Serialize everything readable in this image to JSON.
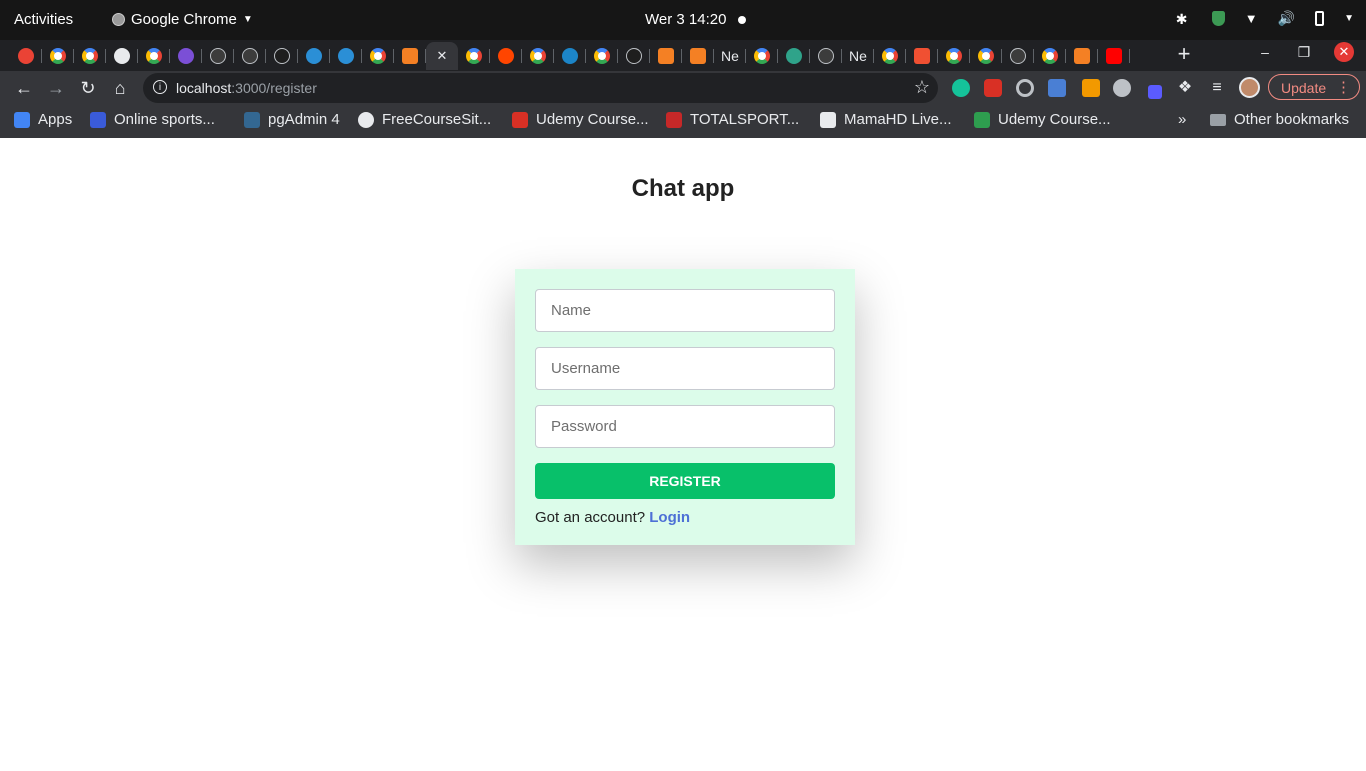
{
  "os_topbar": {
    "activities": "Activities",
    "app_name": "Google Chrome",
    "clock": "Wer 3  14:20"
  },
  "tabs": [
    {
      "icon": "gmail-icon",
      "active": false
    },
    {
      "icon": "google-icon",
      "active": false
    },
    {
      "icon": "google-icon",
      "active": false
    },
    {
      "icon": "globe-icon",
      "active": false
    },
    {
      "icon": "google-icon",
      "active": false
    },
    {
      "icon": "layers-icon",
      "active": false
    },
    {
      "icon": "github-icon",
      "active": false
    },
    {
      "icon": "github-icon",
      "active": false
    },
    {
      "icon": "compass-icon",
      "active": false
    },
    {
      "icon": "mysql-icon",
      "active": false
    },
    {
      "icon": "mysql-icon",
      "active": false
    },
    {
      "icon": "google-icon",
      "active": false
    },
    {
      "icon": "stackoverflow-icon",
      "active": false
    },
    {
      "icon": "sa-icon",
      "active": true
    },
    {
      "icon": "google-icon",
      "active": false
    },
    {
      "icon": "reddit-icon",
      "active": false
    },
    {
      "icon": "google-icon",
      "active": false
    },
    {
      "icon": "sequelize-icon",
      "active": false
    },
    {
      "icon": "google-icon",
      "active": false
    },
    {
      "icon": "compass-icon",
      "active": false
    },
    {
      "icon": "stackoverflow-icon",
      "active": false
    },
    {
      "icon": "stackoverflow-icon",
      "active": false
    },
    {
      "icon": "ne-icon",
      "active": false,
      "text": "Ne"
    },
    {
      "icon": "google-icon",
      "active": false
    },
    {
      "icon": "node-icon",
      "active": false
    },
    {
      "icon": "github-icon",
      "active": false
    },
    {
      "icon": "ne-icon",
      "active": false,
      "text": "Ne"
    },
    {
      "icon": "google-icon",
      "active": false
    },
    {
      "icon": "git-icon",
      "active": false
    },
    {
      "icon": "google-icon",
      "active": false
    },
    {
      "icon": "google-icon",
      "active": false
    },
    {
      "icon": "github-icon",
      "active": false
    },
    {
      "icon": "google-icon",
      "active": false
    },
    {
      "icon": "stackoverflow-icon",
      "active": false
    },
    {
      "icon": "youtube-icon",
      "active": false
    }
  ],
  "toolbar": {
    "url_host": "localhost",
    "url_path": ":3000/register",
    "update_label": "Update"
  },
  "bookmarks": [
    {
      "label": "Apps",
      "icon": "apps-grid-icon"
    },
    {
      "label": "Online sports...",
      "icon": "fx-icon"
    },
    {
      "label": "pgAdmin 4",
      "icon": "pg-icon"
    },
    {
      "label": "FreeCourseSit...",
      "icon": "globe-icon"
    },
    {
      "label": "Udemy Course...",
      "icon": "free-icon"
    },
    {
      "label": "TOTALSPORT...",
      "icon": "ts-icon"
    },
    {
      "label": "MamaHD Live...",
      "icon": "ma-icon"
    },
    {
      "label": "Udemy Course...",
      "icon": "u-icon"
    }
  ],
  "other_bookmarks": "Other bookmarks",
  "page": {
    "title": "Chat app",
    "name_placeholder": "Name",
    "username_placeholder": "Username",
    "password_placeholder": "Password",
    "register_label": "REGISTER",
    "account_text": "Got an account?",
    "login_label": "Login"
  },
  "colors": {
    "card_bg": "#dcfcea",
    "register_button": "#08c06a",
    "login_link": "#4d70d6"
  }
}
